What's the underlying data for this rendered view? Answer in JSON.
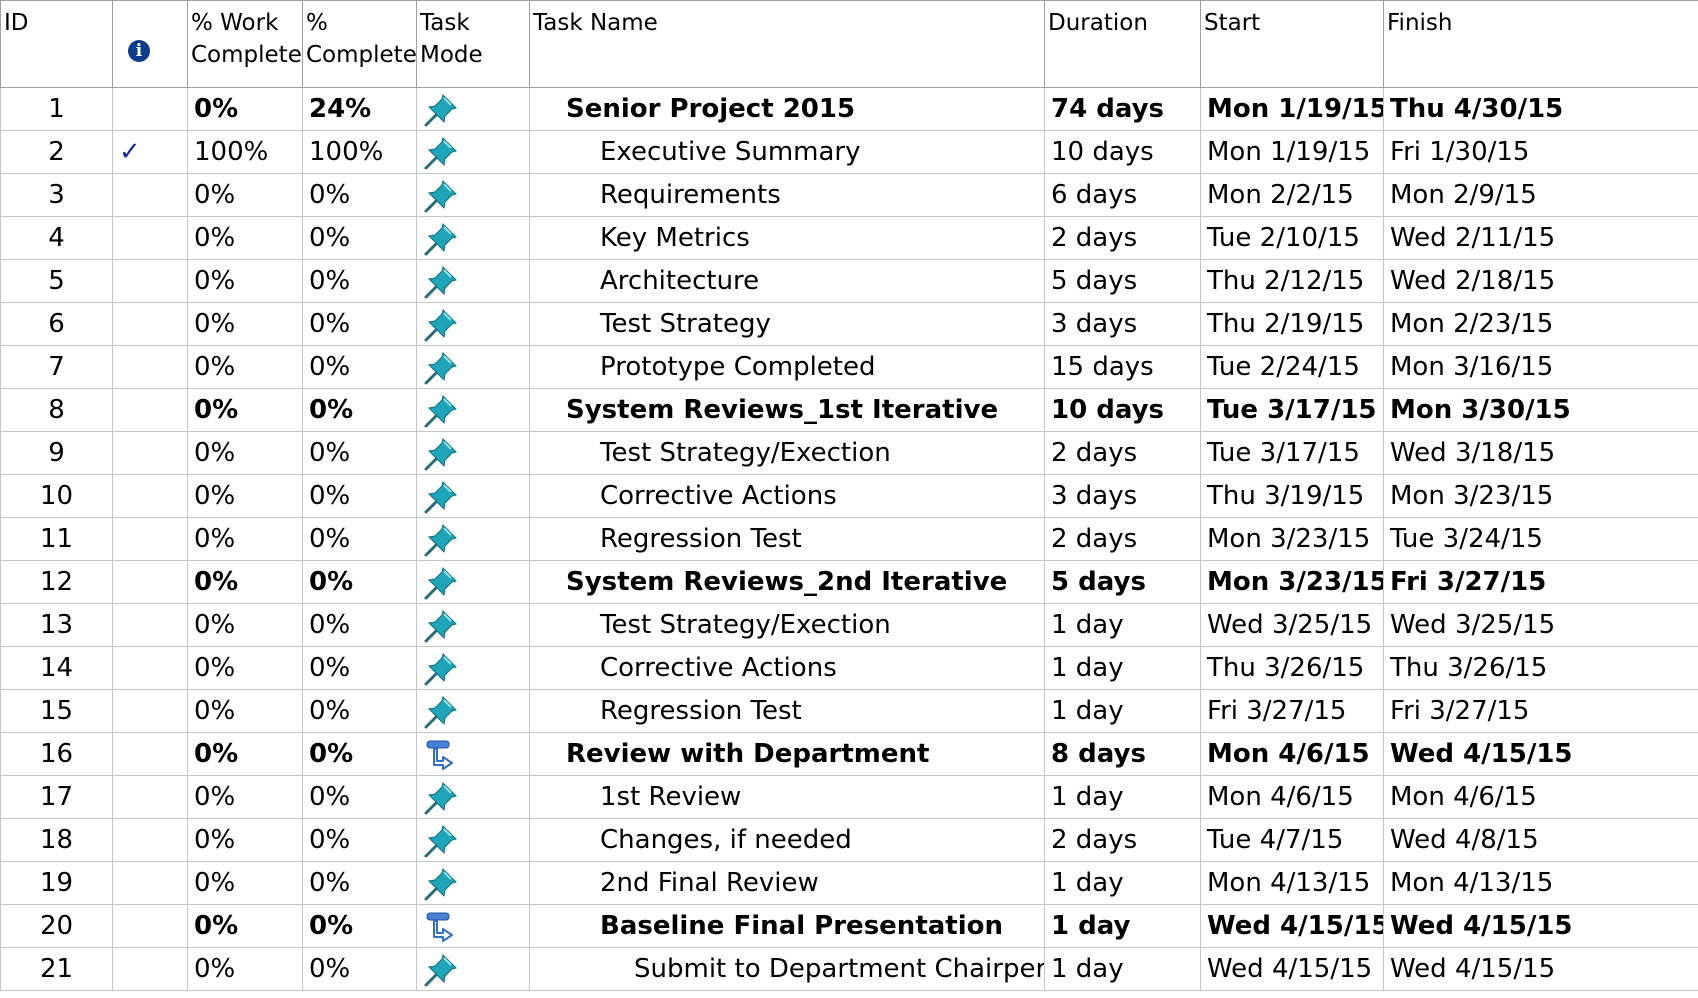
{
  "columns": {
    "id": "ID",
    "indicators_icon": "info-icon",
    "work_complete": "% Work\nComplete",
    "complete": "%\nComplete",
    "task_mode": "Task\nMode",
    "task_name": "Task Name",
    "duration": "Duration",
    "start": "Start",
    "finish": "Finish"
  },
  "rows": [
    {
      "id": "1",
      "check": "",
      "work": "0%",
      "pct": "24%",
      "mode": "manual",
      "name": "Senior Project 2015",
      "level": 0,
      "summary": true,
      "duration": "74 days",
      "start": "Mon 1/19/15",
      "finish": "Thu 4/30/15"
    },
    {
      "id": "2",
      "check": "✓",
      "work": "100%",
      "pct": "100%",
      "mode": "manual",
      "name": "Executive Summary",
      "level": 1,
      "summary": false,
      "duration": "10 days",
      "start": "Mon 1/19/15",
      "finish": "Fri 1/30/15"
    },
    {
      "id": "3",
      "check": "",
      "work": "0%",
      "pct": "0%",
      "mode": "manual",
      "name": "Requirements",
      "level": 1,
      "summary": false,
      "duration": "6 days",
      "start": "Mon 2/2/15",
      "finish": "Mon 2/9/15"
    },
    {
      "id": "4",
      "check": "",
      "work": "0%",
      "pct": "0%",
      "mode": "manual",
      "name": "Key Metrics",
      "level": 1,
      "summary": false,
      "duration": "2 days",
      "start": "Tue 2/10/15",
      "finish": "Wed 2/11/15"
    },
    {
      "id": "5",
      "check": "",
      "work": "0%",
      "pct": "0%",
      "mode": "manual",
      "name": "Architecture",
      "level": 1,
      "summary": false,
      "duration": "5 days",
      "start": "Thu 2/12/15",
      "finish": "Wed 2/18/15"
    },
    {
      "id": "6",
      "check": "",
      "work": "0%",
      "pct": "0%",
      "mode": "manual",
      "name": "Test Strategy",
      "level": 1,
      "summary": false,
      "duration": "3 days",
      "start": "Thu 2/19/15",
      "finish": "Mon 2/23/15"
    },
    {
      "id": "7",
      "check": "",
      "work": "0%",
      "pct": "0%",
      "mode": "manual",
      "name": "Prototype Completed",
      "level": 1,
      "summary": false,
      "duration": "15 days",
      "start": "Tue 2/24/15",
      "finish": "Mon 3/16/15"
    },
    {
      "id": "8",
      "check": "",
      "work": "0%",
      "pct": "0%",
      "mode": "manual",
      "name": "System Reviews_1st Iterative",
      "level": 0,
      "summary": true,
      "duration": "10 days",
      "start": "Tue 3/17/15",
      "finish": "Mon 3/30/15"
    },
    {
      "id": "9",
      "check": "",
      "work": "0%",
      "pct": "0%",
      "mode": "manual",
      "name": "Test Strategy/Exection",
      "level": 1,
      "summary": false,
      "duration": "2 days",
      "start": "Tue 3/17/15",
      "finish": "Wed 3/18/15"
    },
    {
      "id": "10",
      "check": "",
      "work": "0%",
      "pct": "0%",
      "mode": "manual",
      "name": "Corrective Actions",
      "level": 1,
      "summary": false,
      "duration": "3 days",
      "start": "Thu 3/19/15",
      "finish": "Mon 3/23/15"
    },
    {
      "id": "11",
      "check": "",
      "work": "0%",
      "pct": "0%",
      "mode": "manual",
      "name": "Regression Test",
      "level": 1,
      "summary": false,
      "duration": "2 days",
      "start": "Mon 3/23/15",
      "finish": "Tue 3/24/15"
    },
    {
      "id": "12",
      "check": "",
      "work": "0%",
      "pct": "0%",
      "mode": "manual",
      "name": "System Reviews_2nd Iterative",
      "level": 0,
      "summary": true,
      "duration": "5 days",
      "start": "Mon 3/23/15",
      "finish": "Fri 3/27/15"
    },
    {
      "id": "13",
      "check": "",
      "work": "0%",
      "pct": "0%",
      "mode": "manual",
      "name": "Test Strategy/Exection",
      "level": 1,
      "summary": false,
      "duration": "1 day",
      "start": "Wed 3/25/15",
      "finish": "Wed 3/25/15"
    },
    {
      "id": "14",
      "check": "",
      "work": "0%",
      "pct": "0%",
      "mode": "manual",
      "name": "Corrective Actions",
      "level": 1,
      "summary": false,
      "duration": "1 day",
      "start": "Thu 3/26/15",
      "finish": "Thu 3/26/15"
    },
    {
      "id": "15",
      "check": "",
      "work": "0%",
      "pct": "0%",
      "mode": "manual",
      "name": "Regression Test",
      "level": 1,
      "summary": false,
      "duration": "1 day",
      "start": "Fri 3/27/15",
      "finish": "Fri 3/27/15"
    },
    {
      "id": "16",
      "check": "",
      "work": "0%",
      "pct": "0%",
      "mode": "auto",
      "name": "Review with Department",
      "level": 0,
      "summary": true,
      "duration": "8 days",
      "start": "Mon 4/6/15",
      "finish": "Wed 4/15/15"
    },
    {
      "id": "17",
      "check": "",
      "work": "0%",
      "pct": "0%",
      "mode": "manual",
      "name": "1st Review",
      "level": 1,
      "summary": false,
      "duration": "1 day",
      "start": "Mon 4/6/15",
      "finish": "Mon 4/6/15"
    },
    {
      "id": "18",
      "check": "",
      "work": "0%",
      "pct": "0%",
      "mode": "manual",
      "name": "Changes, if needed",
      "level": 1,
      "summary": false,
      "duration": "2 days",
      "start": "Tue 4/7/15",
      "finish": "Wed 4/8/15"
    },
    {
      "id": "19",
      "check": "",
      "work": "0%",
      "pct": "0%",
      "mode": "manual",
      "name": "2nd Final Review",
      "level": 1,
      "summary": false,
      "duration": "1 day",
      "start": "Mon 4/13/15",
      "finish": "Mon 4/13/15"
    },
    {
      "id": "20",
      "check": "",
      "work": "0%",
      "pct": "0%",
      "mode": "auto",
      "name": "Baseline Final Presentation",
      "level": 1,
      "summary": true,
      "duration": "1 day",
      "start": "Wed 4/15/15",
      "finish": "Wed 4/15/15"
    },
    {
      "id": "21",
      "check": "",
      "work": "0%",
      "pct": "0%",
      "mode": "manual",
      "name": "Submit to Department Chairperson",
      "level": 2,
      "summary": false,
      "duration": "1 day",
      "start": "Wed 4/15/15",
      "finish": "Wed 4/15/15"
    }
  ],
  "icons": {
    "manual": "pushpin-icon",
    "auto": "auto-schedule-icon"
  },
  "colors": {
    "grid_line": "#c6c6c6",
    "check": "#1b2aa8",
    "info_icon": "#0b3d8f",
    "pin": "#1fa5b8"
  }
}
